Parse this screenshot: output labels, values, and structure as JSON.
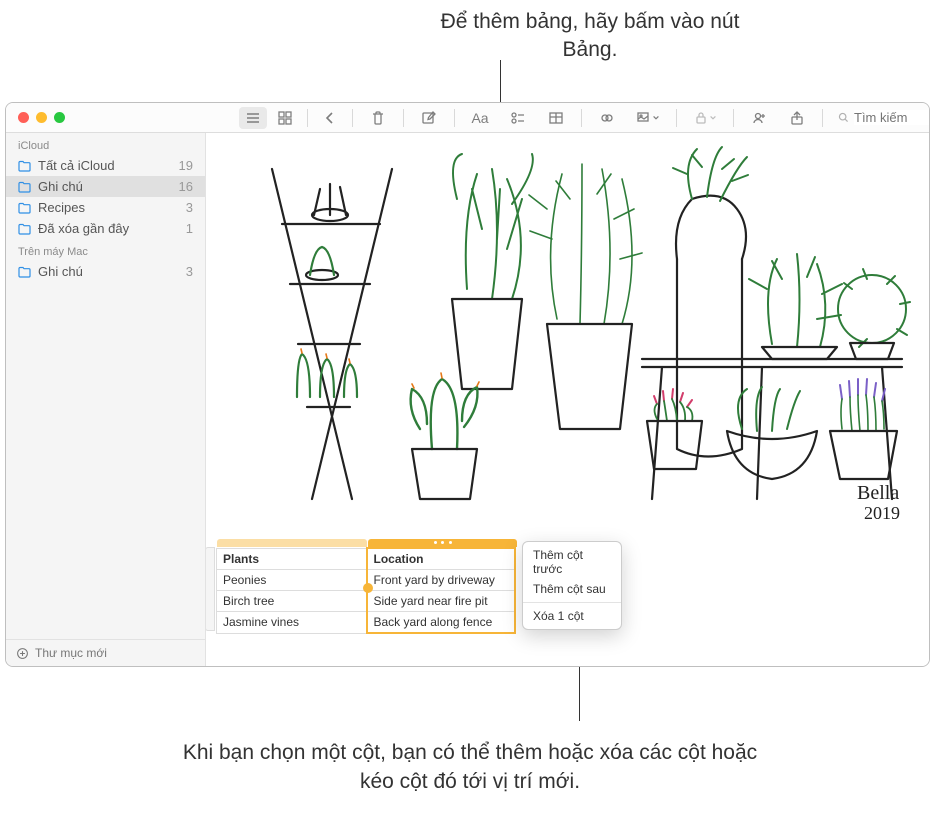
{
  "callouts": {
    "top": "Để thêm bảng, hãy bấm vào nút Bảng.",
    "bottom": "Khi bạn chọn một cột, bạn có thể thêm hoặc xóa các cột hoặc kéo cột đó tới vị trí mới."
  },
  "toolbar": {
    "search_placeholder": "Tìm kiếm"
  },
  "sidebar": {
    "sections": [
      {
        "title": "iCloud",
        "items": [
          {
            "name": "Tất cả iCloud",
            "count": "19",
            "selected": false
          },
          {
            "name": "Ghi chú",
            "count": "16",
            "selected": true
          },
          {
            "name": "Recipes",
            "count": "3",
            "selected": false
          },
          {
            "name": "Đã xóa gần đây",
            "count": "1",
            "selected": false
          }
        ]
      },
      {
        "title": "Trên máy Mac",
        "items": [
          {
            "name": "Ghi chú",
            "count": "3",
            "selected": false
          }
        ]
      }
    ],
    "new_folder": "Thư mục mới"
  },
  "sketch_signature": "Bella 2019",
  "table": {
    "headers": [
      "Plants",
      "Location"
    ],
    "rows": [
      [
        "Peonies",
        "Front yard by driveway"
      ],
      [
        "Birch tree",
        "Side yard near fire pit"
      ],
      [
        "Jasmine vines",
        "Back yard along fence"
      ]
    ]
  },
  "context_menu": {
    "items": [
      "Thêm cột trước",
      "Thêm cột sau"
    ],
    "delete": "Xóa 1 cột"
  }
}
